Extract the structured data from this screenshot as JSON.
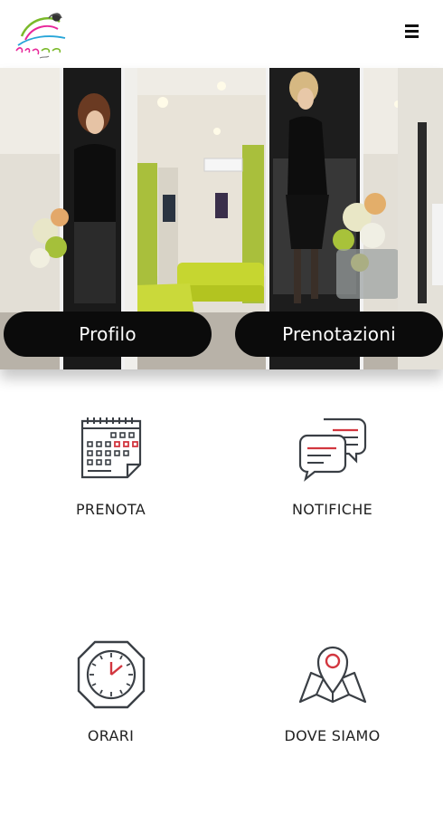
{
  "header": {
    "logo_icon": "salon-logo-icon",
    "menu_icon": "hamburger-menu-icon"
  },
  "hero": {
    "profile_label": "Profilo",
    "bookings_label": "Prenotazioni"
  },
  "tiles": [
    {
      "label": "PRENOTA",
      "icon": "calendar-icon"
    },
    {
      "label": "NOTIFICHE",
      "icon": "chat-bubbles-icon"
    },
    {
      "label": "ORARI",
      "icon": "clock-icon"
    },
    {
      "label": "DOVE SIAMO",
      "icon": "map-pin-icon"
    }
  ],
  "colors": {
    "icon_stroke": "#3a3f45",
    "accent": "#d2363f",
    "pill_bg": "#0b0b0b"
  }
}
